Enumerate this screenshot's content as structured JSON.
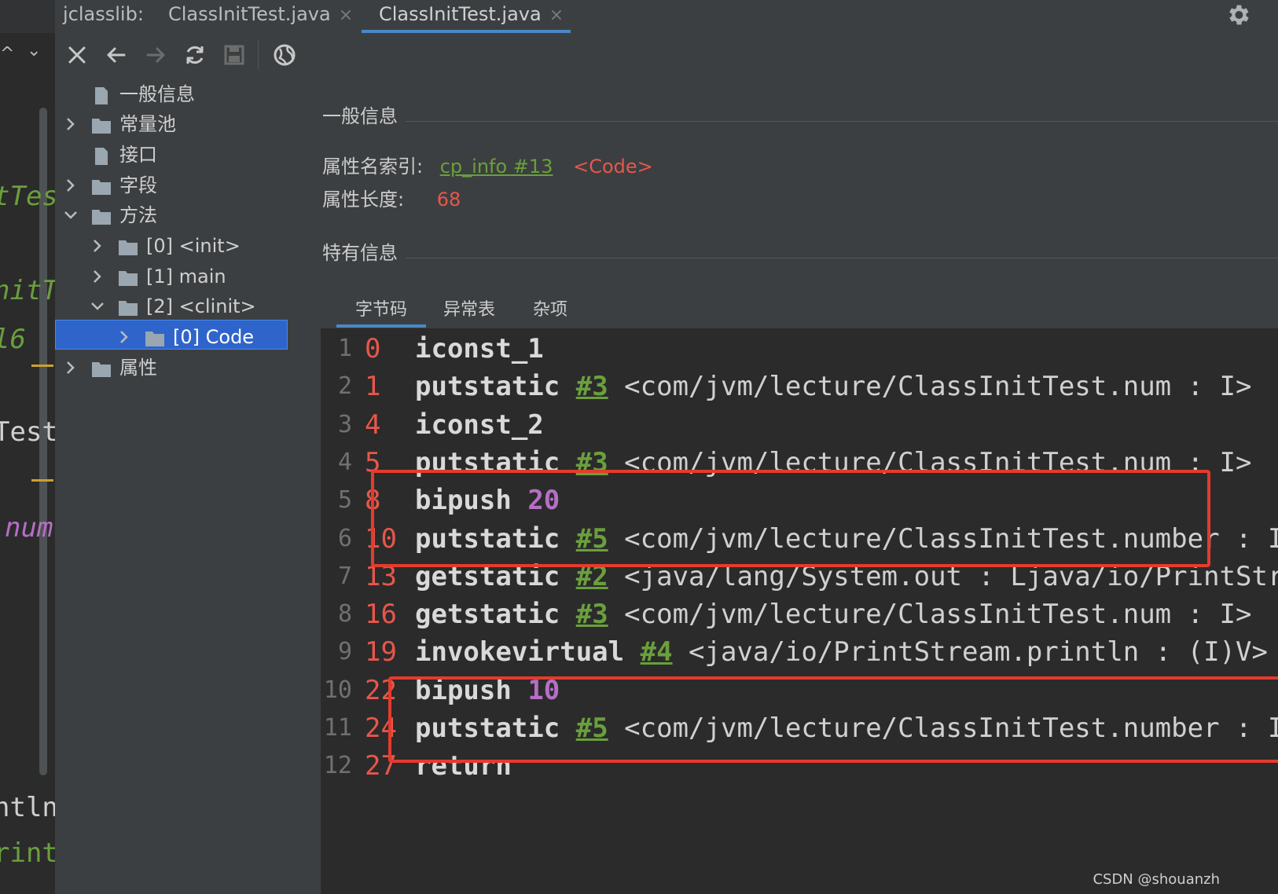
{
  "tabs": [
    {
      "label": "jclasslib:",
      "close": ""
    },
    {
      "label": "ClassInitTest.java",
      "close": "×"
    },
    {
      "label": "ClassInitTest.java",
      "close": "×",
      "active": true
    }
  ],
  "editor_strip": {
    "nav_up": "^",
    "nav_down": "⌄",
    "fragments": [
      "tTes",
      "nitT",
      "l6",
      "Test",
      "num",
      "ntln",
      "rint"
    ]
  },
  "toolbar_icons": [
    "close-icon",
    "back-icon",
    "forward-icon",
    "refresh-icon",
    "save-icon",
    "web-icon"
  ],
  "tree": {
    "items": [
      {
        "label": "一般信息",
        "icon": "file-icon",
        "expanded": null
      },
      {
        "label": "常量池",
        "icon": "folder-icon",
        "expanded": false
      },
      {
        "label": "接口",
        "icon": "file-icon",
        "expanded": null
      },
      {
        "label": "字段",
        "icon": "folder-icon",
        "expanded": false
      },
      {
        "label": "方法",
        "icon": "folder-icon",
        "expanded": true
      },
      {
        "label": "[0] <init>",
        "icon": "folder-icon",
        "expanded": false
      },
      {
        "label": "[1] main",
        "icon": "folder-icon",
        "expanded": false
      },
      {
        "label": "[2] <clinit>",
        "icon": "folder-icon",
        "expanded": true
      },
      {
        "label": "[0] Code",
        "icon": "folder-icon",
        "expanded": false,
        "selected": true
      },
      {
        "label": "属性",
        "icon": "folder-icon",
        "expanded": false
      }
    ]
  },
  "detail": {
    "general_title": "一般信息",
    "attr_name_index_label": "属性名索引:",
    "attr_name_index_link": "cp_info #13",
    "attr_name_index_value": "<Code>",
    "attr_length_label": "属性长度:",
    "attr_length_value": "68",
    "specific_title": "特有信息",
    "subtabs": [
      "字节码",
      "异常表",
      "杂项"
    ],
    "active_subtab": "字节码"
  },
  "bytecode": [
    {
      "line": "1",
      "offset": "0",
      "instr": "iconst_1",
      "cref": "",
      "arg": "",
      "desc": ""
    },
    {
      "line": "2",
      "offset": "1",
      "instr": "putstatic",
      "cref": "#3",
      "arg": "",
      "desc": "<com/jvm/lecture/ClassInitTest.num : I>"
    },
    {
      "line": "3",
      "offset": "4",
      "instr": "iconst_2",
      "cref": "",
      "arg": "",
      "desc": ""
    },
    {
      "line": "4",
      "offset": "5",
      "instr": "putstatic",
      "cref": "#3",
      "arg": "",
      "desc": "<com/jvm/lecture/ClassInitTest.num : I>"
    },
    {
      "line": "5",
      "offset": "8",
      "instr": "bipush",
      "cref": "",
      "arg": "20",
      "desc": ""
    },
    {
      "line": "6",
      "offset": "10",
      "instr": "putstatic",
      "cref": "#5",
      "arg": "",
      "desc": "<com/jvm/lecture/ClassInitTest.number : I>"
    },
    {
      "line": "7",
      "offset": "13",
      "instr": "getstatic",
      "cref": "#2",
      "arg": "",
      "desc": "<java/lang/System.out : Ljava/io/PrintStream;>"
    },
    {
      "line": "8",
      "offset": "16",
      "instr": "getstatic",
      "cref": "#3",
      "arg": "",
      "desc": "<com/jvm/lecture/ClassInitTest.num : I>"
    },
    {
      "line": "9",
      "offset": "19",
      "instr": "invokevirtual",
      "cref": "#4",
      "arg": "",
      "desc": "<java/io/PrintStream.println : (I)V>"
    },
    {
      "line": "10",
      "offset": "22",
      "instr": "bipush",
      "cref": "",
      "arg": "10",
      "desc": ""
    },
    {
      "line": "11",
      "offset": "24",
      "instr": "putstatic",
      "cref": "#5",
      "arg": "",
      "desc": "<com/jvm/lecture/ClassInitTest.number : I>"
    },
    {
      "line": "12",
      "offset": "27",
      "instr": "return",
      "cref": "",
      "arg": "",
      "desc": ""
    }
  ],
  "watermark": "CSDN @shouanzh",
  "colors": {
    "accent": "#4a88c7",
    "selection": "#2f65ca",
    "highlight_box": "#e53b2c",
    "cp_link": "#6a9f3d",
    "offset": "#e8564a",
    "number_arg": "#b56fc4"
  }
}
